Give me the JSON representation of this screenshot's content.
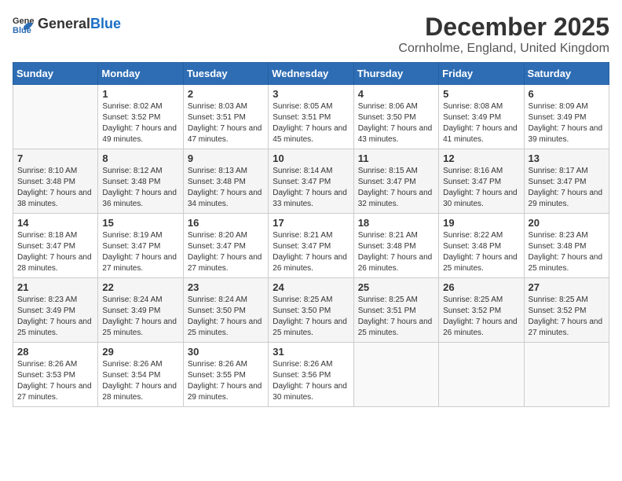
{
  "logo": {
    "general": "General",
    "blue": "Blue"
  },
  "header": {
    "month": "December 2025",
    "location": "Cornholme, England, United Kingdom"
  },
  "weekdays": [
    "Sunday",
    "Monday",
    "Tuesday",
    "Wednesday",
    "Thursday",
    "Friday",
    "Saturday"
  ],
  "weeks": [
    [
      {
        "day": "",
        "sunrise": "",
        "sunset": "",
        "daylight": ""
      },
      {
        "day": "1",
        "sunrise": "Sunrise: 8:02 AM",
        "sunset": "Sunset: 3:52 PM",
        "daylight": "Daylight: 7 hours and 49 minutes."
      },
      {
        "day": "2",
        "sunrise": "Sunrise: 8:03 AM",
        "sunset": "Sunset: 3:51 PM",
        "daylight": "Daylight: 7 hours and 47 minutes."
      },
      {
        "day": "3",
        "sunrise": "Sunrise: 8:05 AM",
        "sunset": "Sunset: 3:51 PM",
        "daylight": "Daylight: 7 hours and 45 minutes."
      },
      {
        "day": "4",
        "sunrise": "Sunrise: 8:06 AM",
        "sunset": "Sunset: 3:50 PM",
        "daylight": "Daylight: 7 hours and 43 minutes."
      },
      {
        "day": "5",
        "sunrise": "Sunrise: 8:08 AM",
        "sunset": "Sunset: 3:49 PM",
        "daylight": "Daylight: 7 hours and 41 minutes."
      },
      {
        "day": "6",
        "sunrise": "Sunrise: 8:09 AM",
        "sunset": "Sunset: 3:49 PM",
        "daylight": "Daylight: 7 hours and 39 minutes."
      }
    ],
    [
      {
        "day": "7",
        "sunrise": "Sunrise: 8:10 AM",
        "sunset": "Sunset: 3:48 PM",
        "daylight": "Daylight: 7 hours and 38 minutes."
      },
      {
        "day": "8",
        "sunrise": "Sunrise: 8:12 AM",
        "sunset": "Sunset: 3:48 PM",
        "daylight": "Daylight: 7 hours and 36 minutes."
      },
      {
        "day": "9",
        "sunrise": "Sunrise: 8:13 AM",
        "sunset": "Sunset: 3:48 PM",
        "daylight": "Daylight: 7 hours and 34 minutes."
      },
      {
        "day": "10",
        "sunrise": "Sunrise: 8:14 AM",
        "sunset": "Sunset: 3:47 PM",
        "daylight": "Daylight: 7 hours and 33 minutes."
      },
      {
        "day": "11",
        "sunrise": "Sunrise: 8:15 AM",
        "sunset": "Sunset: 3:47 PM",
        "daylight": "Daylight: 7 hours and 32 minutes."
      },
      {
        "day": "12",
        "sunrise": "Sunrise: 8:16 AM",
        "sunset": "Sunset: 3:47 PM",
        "daylight": "Daylight: 7 hours and 30 minutes."
      },
      {
        "day": "13",
        "sunrise": "Sunrise: 8:17 AM",
        "sunset": "Sunset: 3:47 PM",
        "daylight": "Daylight: 7 hours and 29 minutes."
      }
    ],
    [
      {
        "day": "14",
        "sunrise": "Sunrise: 8:18 AM",
        "sunset": "Sunset: 3:47 PM",
        "daylight": "Daylight: 7 hours and 28 minutes."
      },
      {
        "day": "15",
        "sunrise": "Sunrise: 8:19 AM",
        "sunset": "Sunset: 3:47 PM",
        "daylight": "Daylight: 7 hours and 27 minutes."
      },
      {
        "day": "16",
        "sunrise": "Sunrise: 8:20 AM",
        "sunset": "Sunset: 3:47 PM",
        "daylight": "Daylight: 7 hours and 27 minutes."
      },
      {
        "day": "17",
        "sunrise": "Sunrise: 8:21 AM",
        "sunset": "Sunset: 3:47 PM",
        "daylight": "Daylight: 7 hours and 26 minutes."
      },
      {
        "day": "18",
        "sunrise": "Sunrise: 8:21 AM",
        "sunset": "Sunset: 3:48 PM",
        "daylight": "Daylight: 7 hours and 26 minutes."
      },
      {
        "day": "19",
        "sunrise": "Sunrise: 8:22 AM",
        "sunset": "Sunset: 3:48 PM",
        "daylight": "Daylight: 7 hours and 25 minutes."
      },
      {
        "day": "20",
        "sunrise": "Sunrise: 8:23 AM",
        "sunset": "Sunset: 3:48 PM",
        "daylight": "Daylight: 7 hours and 25 minutes."
      }
    ],
    [
      {
        "day": "21",
        "sunrise": "Sunrise: 8:23 AM",
        "sunset": "Sunset: 3:49 PM",
        "daylight": "Daylight: 7 hours and 25 minutes."
      },
      {
        "day": "22",
        "sunrise": "Sunrise: 8:24 AM",
        "sunset": "Sunset: 3:49 PM",
        "daylight": "Daylight: 7 hours and 25 minutes."
      },
      {
        "day": "23",
        "sunrise": "Sunrise: 8:24 AM",
        "sunset": "Sunset: 3:50 PM",
        "daylight": "Daylight: 7 hours and 25 minutes."
      },
      {
        "day": "24",
        "sunrise": "Sunrise: 8:25 AM",
        "sunset": "Sunset: 3:50 PM",
        "daylight": "Daylight: 7 hours and 25 minutes."
      },
      {
        "day": "25",
        "sunrise": "Sunrise: 8:25 AM",
        "sunset": "Sunset: 3:51 PM",
        "daylight": "Daylight: 7 hours and 25 minutes."
      },
      {
        "day": "26",
        "sunrise": "Sunrise: 8:25 AM",
        "sunset": "Sunset: 3:52 PM",
        "daylight": "Daylight: 7 hours and 26 minutes."
      },
      {
        "day": "27",
        "sunrise": "Sunrise: 8:25 AM",
        "sunset": "Sunset: 3:52 PM",
        "daylight": "Daylight: 7 hours and 27 minutes."
      }
    ],
    [
      {
        "day": "28",
        "sunrise": "Sunrise: 8:26 AM",
        "sunset": "Sunset: 3:53 PM",
        "daylight": "Daylight: 7 hours and 27 minutes."
      },
      {
        "day": "29",
        "sunrise": "Sunrise: 8:26 AM",
        "sunset": "Sunset: 3:54 PM",
        "daylight": "Daylight: 7 hours and 28 minutes."
      },
      {
        "day": "30",
        "sunrise": "Sunrise: 8:26 AM",
        "sunset": "Sunset: 3:55 PM",
        "daylight": "Daylight: 7 hours and 29 minutes."
      },
      {
        "day": "31",
        "sunrise": "Sunrise: 8:26 AM",
        "sunset": "Sunset: 3:56 PM",
        "daylight": "Daylight: 7 hours and 30 minutes."
      },
      {
        "day": "",
        "sunrise": "",
        "sunset": "",
        "daylight": ""
      },
      {
        "day": "",
        "sunrise": "",
        "sunset": "",
        "daylight": ""
      },
      {
        "day": "",
        "sunrise": "",
        "sunset": "",
        "daylight": ""
      }
    ]
  ]
}
